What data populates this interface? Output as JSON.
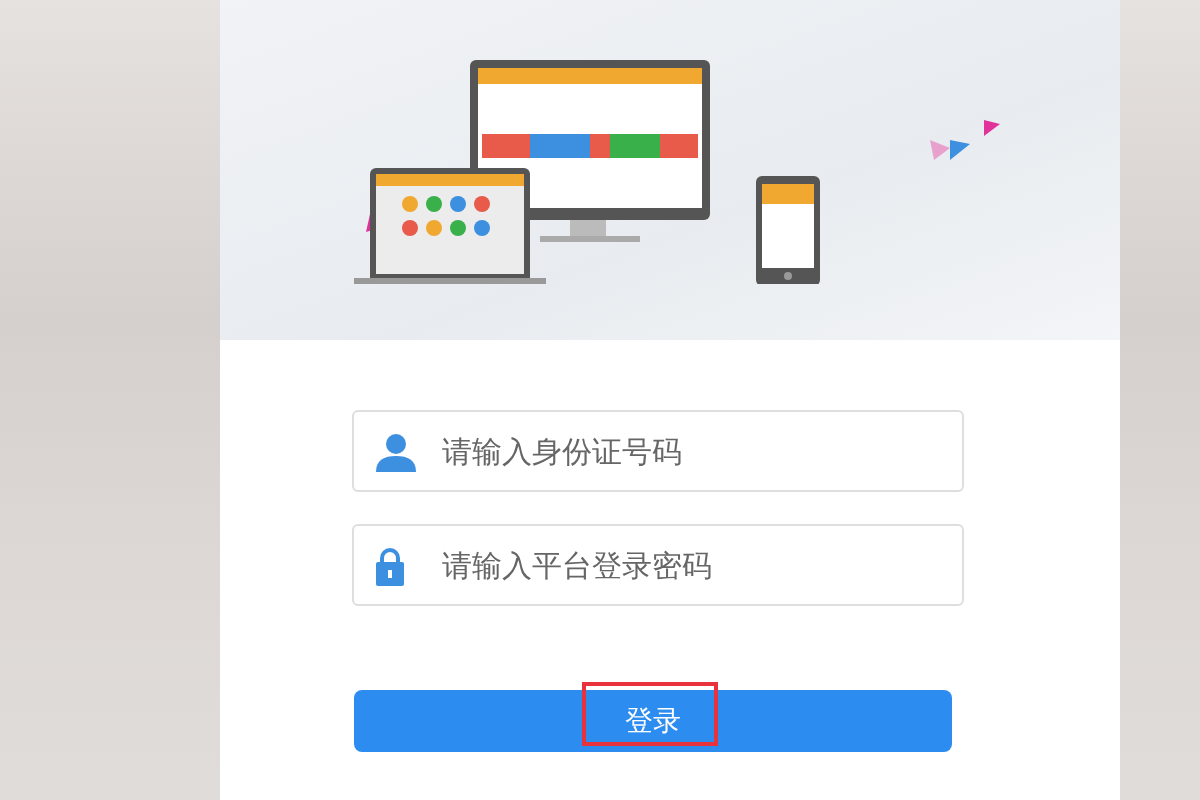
{
  "login_form": {
    "fields": [
      {
        "kind": "user",
        "placeholder": "请输入身份证号码"
      },
      {
        "kind": "lock",
        "placeholder": "请输入平台登录密码"
      }
    ],
    "submit": {
      "label": "登录",
      "highlighted": true
    }
  }
}
